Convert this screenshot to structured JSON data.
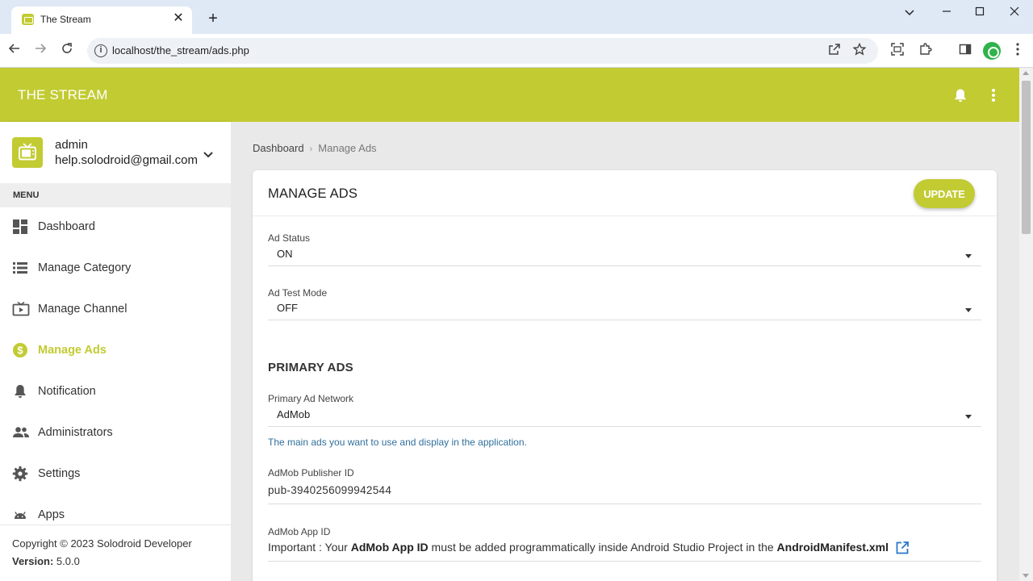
{
  "browser": {
    "tab_title": "The Stream",
    "url": "localhost/the_stream/ads.php"
  },
  "header": {
    "title": "THE STREAM"
  },
  "user": {
    "name": "admin",
    "email": "help.solodroid@gmail.com"
  },
  "sidebar": {
    "menu_header": "MENU",
    "items": [
      {
        "label": "Dashboard",
        "icon": "dashboard-icon",
        "active": false
      },
      {
        "label": "Manage Category",
        "icon": "list-icon",
        "active": false
      },
      {
        "label": "Manage Channel",
        "icon": "tv-icon",
        "active": false
      },
      {
        "label": "Manage Ads",
        "icon": "dollar-icon",
        "active": true
      },
      {
        "label": "Notification",
        "icon": "bell-icon",
        "active": false
      },
      {
        "label": "Administrators",
        "icon": "people-icon",
        "active": false
      },
      {
        "label": "Settings",
        "icon": "gear-icon",
        "active": false
      },
      {
        "label": "Apps",
        "icon": "android-icon",
        "active": false
      }
    ],
    "footer": {
      "copyright": "Copyright © 2023 Solodroid Developer",
      "version_label": "Version:",
      "version_value": " 5.0.0"
    }
  },
  "breadcrumb": {
    "home": "Dashboard",
    "current": "Manage Ads"
  },
  "card": {
    "title": "MANAGE ADS",
    "update_label": "UPDATE",
    "ad_status": {
      "label": "Ad Status",
      "value": "ON"
    },
    "ad_test_mode": {
      "label": "Ad Test Mode",
      "value": "OFF"
    },
    "primary_section": "PRIMARY ADS",
    "primary_network": {
      "label": "Primary Ad Network",
      "value": "AdMob",
      "help": "The main ads you want to use and display in the application."
    },
    "publisher_id": {
      "label": "AdMob Publisher ID",
      "value": "pub-3940256099942544"
    },
    "app_id": {
      "label": "AdMob App ID",
      "note_prefix": "Important : Your ",
      "note_bold1": "AdMob App ID",
      "note_middle": " must be added programmatically inside Android Studio Project in the ",
      "note_bold2": "AndroidManifest.xml"
    }
  },
  "colors": {
    "accent": "#c2cb32",
    "help_text": "#31709b"
  }
}
